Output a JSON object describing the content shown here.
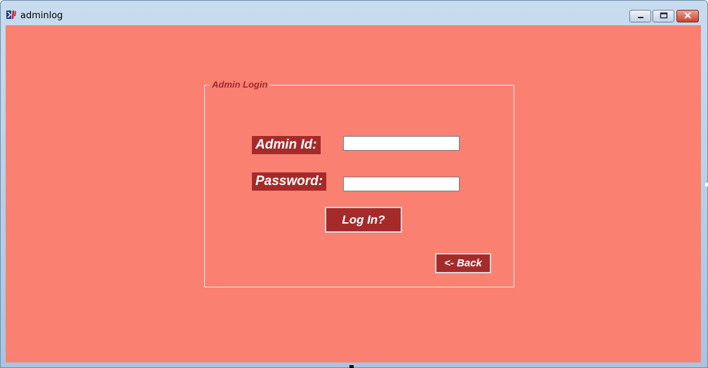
{
  "window": {
    "title": "adminlog",
    "controls": {
      "minimize": "minimize-icon",
      "maximize": "maximize-icon",
      "close": "close-icon"
    }
  },
  "form": {
    "group_title": "Admin Login",
    "admin_id_label": "Admin Id:",
    "admin_id_value": "",
    "password_label": "Password:",
    "password_value": "",
    "login_button": "Log In?",
    "back_button": "<- Back"
  },
  "colors": {
    "background": "#fa8072",
    "accent": "#a52a2a",
    "group_title": "#a02b2e"
  }
}
